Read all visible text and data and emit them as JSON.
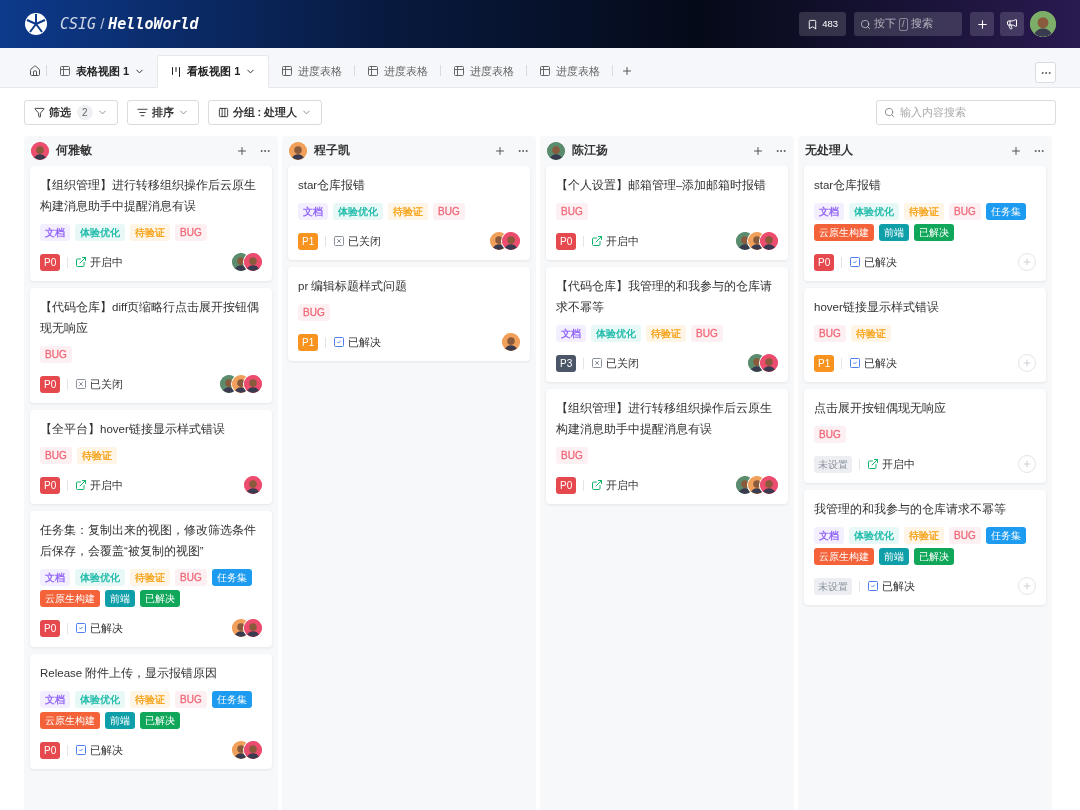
{
  "header": {
    "org": "CSIG",
    "separator": "/",
    "project": "HelloWorld",
    "bookmark_count": "483",
    "search": {
      "prefix": "按下",
      "key": "/",
      "placeholder": "搜索"
    }
  },
  "tabs": [
    {
      "label": "表格视图 1",
      "kind": "table",
      "selected": false,
      "dropdown": true
    },
    {
      "label": "看板视图 1",
      "kind": "board",
      "selected": true,
      "dropdown": true
    },
    {
      "label": "进度表格",
      "kind": "table",
      "selected": false,
      "dropdown": false
    },
    {
      "label": "进度表格",
      "kind": "table",
      "selected": false,
      "dropdown": false
    },
    {
      "label": "进度表格",
      "kind": "table",
      "selected": false,
      "dropdown": false
    },
    {
      "label": "进度表格",
      "kind": "table",
      "selected": false,
      "dropdown": false
    }
  ],
  "toolbar": {
    "filter": {
      "label": "筛选",
      "count": "2"
    },
    "sort": {
      "label": "排序"
    },
    "group": {
      "label": "分组 : 处理人"
    },
    "search": {
      "placeholder": "输入内容搜索"
    }
  },
  "columns": [
    {
      "name": "何雅敏",
      "avatar": {
        "color": "#ec4d6e"
      },
      "cards": [
        {
          "title": "【组织管理】进行转移组织操作后云原生构建消息助手中提醒消息有误",
          "tags": [
            {
              "label": "文档",
              "color": "#8b5cf6",
              "kind": "soft"
            },
            {
              "label": "体验优化",
              "color": "#14b8a6",
              "kind": "soft"
            },
            {
              "label": "待验证",
              "color": "#f59e0b",
              "kind": "soft"
            },
            {
              "label": "BUG",
              "color": "#ef6a7a",
              "kind": "soft"
            }
          ],
          "priority": {
            "label": "P0",
            "color": "#e5484d"
          },
          "status": {
            "label": "开启中",
            "kind": "open"
          },
          "assignees": [
            {
              "color": "#5b8c6e"
            },
            {
              "color": "#ec4d6e"
            }
          ]
        },
        {
          "title": "【代码仓库】diff页缩略行点击展开按钮偶现无响应",
          "tags": [
            {
              "label": "BUG",
              "color": "#ef6a7a",
              "kind": "soft"
            }
          ],
          "priority": {
            "label": "P0",
            "color": "#e5484d"
          },
          "status": {
            "label": "已关闭",
            "kind": "closed"
          },
          "assignees": [
            {
              "color": "#5b8c6e"
            },
            {
              "color": "#f0a05a"
            },
            {
              "color": "#ec4d6e"
            }
          ]
        },
        {
          "title": "【全平台】hover链接显示样式错误",
          "tags": [
            {
              "label": "BUG",
              "color": "#ef6a7a",
              "kind": "soft"
            },
            {
              "label": "待验证",
              "color": "#f59e0b",
              "kind": "soft"
            }
          ],
          "priority": {
            "label": "P0",
            "color": "#e5484d"
          },
          "status": {
            "label": "开启中",
            "kind": "open"
          },
          "assignees": [
            {
              "color": "#ec4d6e"
            }
          ]
        },
        {
          "title": "任务集：复制出来的视图，修改筛选条件后保存，会覆盖“被复制的视图”",
          "tags": [
            {
              "label": "文档",
              "color": "#8b5cf6",
              "kind": "soft"
            },
            {
              "label": "体验优化",
              "color": "#14b8a6",
              "kind": "soft"
            },
            {
              "label": "待验证",
              "color": "#f59e0b",
              "kind": "soft"
            },
            {
              "label": "BUG",
              "color": "#ef6a7a",
              "kind": "soft"
            },
            {
              "label": "任务集",
              "color": "#1d9bf0",
              "kind": "solid"
            },
            {
              "label": "云原生构建",
              "color": "#f4623a",
              "kind": "solid"
            },
            {
              "label": "前端",
              "color": "#0f9fa8",
              "kind": "solid"
            },
            {
              "label": "已解决",
              "color": "#10a75a",
              "kind": "solid"
            }
          ],
          "priority": {
            "label": "P0",
            "color": "#e5484d"
          },
          "status": {
            "label": "已解决",
            "kind": "resolved"
          },
          "assignees": [
            {
              "color": "#f0a05a"
            },
            {
              "color": "#ec4d6e"
            }
          ]
        },
        {
          "title": "Release 附件上传，显示报错原因",
          "tags": [
            {
              "label": "文档",
              "color": "#8b5cf6",
              "kind": "soft"
            },
            {
              "label": "体验优化",
              "color": "#14b8a6",
              "kind": "soft"
            },
            {
              "label": "待验证",
              "color": "#f59e0b",
              "kind": "soft"
            },
            {
              "label": "BUG",
              "color": "#ef6a7a",
              "kind": "soft"
            },
            {
              "label": "任务集",
              "color": "#1d9bf0",
              "kind": "solid"
            },
            {
              "label": "云原生构建",
              "color": "#f4623a",
              "kind": "solid"
            },
            {
              "label": "前端",
              "color": "#0f9fa8",
              "kind": "solid"
            },
            {
              "label": "已解决",
              "color": "#10a75a",
              "kind": "solid"
            }
          ],
          "priority": {
            "label": "P0",
            "color": "#e5484d"
          },
          "status": {
            "label": "已解决",
            "kind": "resolved"
          },
          "assignees": [
            {
              "color": "#f0a05a"
            },
            {
              "color": "#ec4d6e"
            }
          ]
        }
      ]
    },
    {
      "name": "程子凯",
      "avatar": {
        "color": "#f0a05a"
      },
      "cards": [
        {
          "title": "star仓库报错",
          "tags": [
            {
              "label": "文档",
              "color": "#8b5cf6",
              "kind": "soft"
            },
            {
              "label": "体验优化",
              "color": "#14b8a6",
              "kind": "soft"
            },
            {
              "label": "待验证",
              "color": "#f59e0b",
              "kind": "soft"
            },
            {
              "label": "BUG",
              "color": "#ef6a7a",
              "kind": "soft"
            }
          ],
          "priority": {
            "label": "P1",
            "color": "#f7931e"
          },
          "status": {
            "label": "已关闭",
            "kind": "closed"
          },
          "assignees": [
            {
              "color": "#f0a05a"
            },
            {
              "color": "#ec4d6e"
            }
          ]
        },
        {
          "title": "pr 编辑标题样式问题",
          "tags": [
            {
              "label": "BUG",
              "color": "#ef6a7a",
              "kind": "soft"
            }
          ],
          "priority": {
            "label": "P1",
            "color": "#f7931e"
          },
          "status": {
            "label": "已解决",
            "kind": "resolved"
          },
          "assignees": [
            {
              "color": "#f0a05a"
            }
          ]
        }
      ]
    },
    {
      "name": "陈江扬",
      "avatar": {
        "color": "#5b8c6e"
      },
      "cards": [
        {
          "title": "【个人设置】邮箱管理–添加邮箱时报错",
          "tags": [
            {
              "label": "BUG",
              "color": "#ef6a7a",
              "kind": "soft"
            }
          ],
          "priority": {
            "label": "P0",
            "color": "#e5484d"
          },
          "status": {
            "label": "开启中",
            "kind": "open"
          },
          "assignees": [
            {
              "color": "#5b8c6e"
            },
            {
              "color": "#f0a05a"
            },
            {
              "color": "#ec4d6e"
            }
          ]
        },
        {
          "title": "【代码仓库】我管理的和我参与的仓库请求不幂等",
          "tags": [
            {
              "label": "文档",
              "color": "#8b5cf6",
              "kind": "soft"
            },
            {
              "label": "体验优化",
              "color": "#14b8a6",
              "kind": "soft"
            },
            {
              "label": "待验证",
              "color": "#f59e0b",
              "kind": "soft"
            },
            {
              "label": "BUG",
              "color": "#ef6a7a",
              "kind": "soft"
            }
          ],
          "priority": {
            "label": "P3",
            "color": "#4b5568"
          },
          "status": {
            "label": "已关闭",
            "kind": "closed"
          },
          "assignees": [
            {
              "color": "#5b8c6e"
            },
            {
              "color": "#ec4d6e"
            }
          ]
        },
        {
          "title": "【组织管理】进行转移组织操作后云原生构建消息助手中提醒消息有误",
          "tags": [
            {
              "label": "BUG",
              "color": "#ef6a7a",
              "kind": "soft"
            }
          ],
          "priority": {
            "label": "P0",
            "color": "#e5484d"
          },
          "status": {
            "label": "开启中",
            "kind": "open"
          },
          "assignees": [
            {
              "color": "#5b8c6e"
            },
            {
              "color": "#f0a05a"
            },
            {
              "color": "#ec4d6e"
            }
          ]
        }
      ]
    },
    {
      "name": "无处理人",
      "cards": [
        {
          "title": "star仓库报错",
          "tags": [
            {
              "label": "文档",
              "color": "#8b5cf6",
              "kind": "soft"
            },
            {
              "label": "体验优化",
              "color": "#14b8a6",
              "kind": "soft"
            },
            {
              "label": "待验证",
              "color": "#f59e0b",
              "kind": "soft"
            },
            {
              "label": "BUG",
              "color": "#ef6a7a",
              "kind": "soft"
            },
            {
              "label": "任务集",
              "color": "#1d9bf0",
              "kind": "solid"
            },
            {
              "label": "云原生构建",
              "color": "#f4623a",
              "kind": "solid"
            },
            {
              "label": "前端",
              "color": "#0f9fa8",
              "kind": "solid"
            },
            {
              "label": "已解决",
              "color": "#10a75a",
              "kind": "solid"
            }
          ],
          "priority": {
            "label": "P0",
            "color": "#e5484d"
          },
          "status": {
            "label": "已解决",
            "kind": "resolved"
          }
        },
        {
          "title": "hover链接显示样式错误",
          "tags": [
            {
              "label": "BUG",
              "color": "#ef6a7a",
              "kind": "soft"
            },
            {
              "label": "待验证",
              "color": "#f59e0b",
              "kind": "soft"
            }
          ],
          "priority": {
            "label": "P1",
            "color": "#f7931e"
          },
          "status": {
            "label": "已解决",
            "kind": "resolved"
          }
        },
        {
          "title": "点击展开按钮偶现无响应",
          "tags": [
            {
              "label": "BUG",
              "color": "#ef6a7a",
              "kind": "soft"
            }
          ],
          "priority": {
            "label": "未设置",
            "color": "#eceef2"
          },
          "status": {
            "label": "开启中",
            "kind": "open"
          }
        },
        {
          "title": "我管理的和我参与的仓库请求不幂等",
          "tags": [
            {
              "label": "文档",
              "color": "#8b5cf6",
              "kind": "soft"
            },
            {
              "label": "体验优化",
              "color": "#14b8a6",
              "kind": "soft"
            },
            {
              "label": "待验证",
              "color": "#f59e0b",
              "kind": "soft"
            },
            {
              "label": "BUG",
              "color": "#ef6a7a",
              "kind": "soft"
            },
            {
              "label": "任务集",
              "color": "#1d9bf0",
              "kind": "solid"
            },
            {
              "label": "云原生构建",
              "color": "#f4623a",
              "kind": "solid"
            },
            {
              "label": "前端",
              "color": "#0f9fa8",
              "kind": "solid"
            },
            {
              "label": "已解决",
              "color": "#10a75a",
              "kind": "solid"
            }
          ],
          "priority": {
            "label": "未设置",
            "color": "#eceef2"
          },
          "status": {
            "label": "已解决",
            "kind": "resolved"
          }
        }
      ]
    }
  ]
}
